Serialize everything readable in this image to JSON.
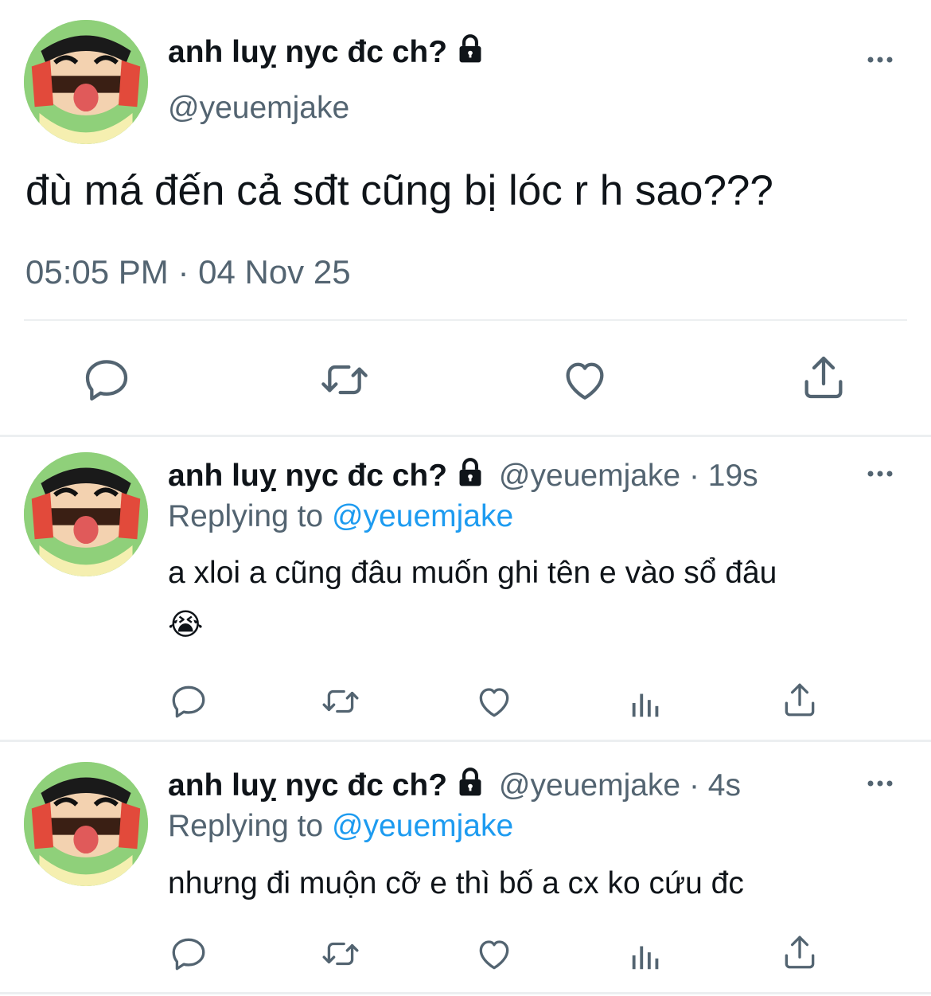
{
  "main_tweet": {
    "display_name": "anh luỵ nyc đc ch?",
    "handle": "@yeuemjake",
    "text": "đù má đến cả sđt cũng bị lóc r h sao???",
    "timestamp": "05:05 PM · 04 Nov 25"
  },
  "replies": [
    {
      "display_name": "anh luỵ nyc đc ch?",
      "handle": "@yeuemjake",
      "age": "19s",
      "replying_prefix": "Replying to",
      "replying_to": "@yeuemjake",
      "text": "a xloi a cũng đâu muốn ghi tên e vào sổ đâu",
      "emoji": "😭"
    },
    {
      "display_name": "anh luỵ nyc đc ch?",
      "handle": "@yeuemjake",
      "age": "4s",
      "replying_prefix": "Replying to",
      "replying_to": "@yeuemjake",
      "text": "nhưng đi muộn cỡ e thì bố a cx ko cứu đc"
    }
  ],
  "colors": {
    "text": "#0f1419",
    "muted": "#536471",
    "link": "#1d9bf0",
    "divider": "#eceff1",
    "avatar_bg": "#8fd07a"
  },
  "icons": [
    "lock-icon",
    "more-icon",
    "reply-icon",
    "retweet-icon",
    "like-icon",
    "share-icon",
    "views-icon",
    "avatar"
  ]
}
